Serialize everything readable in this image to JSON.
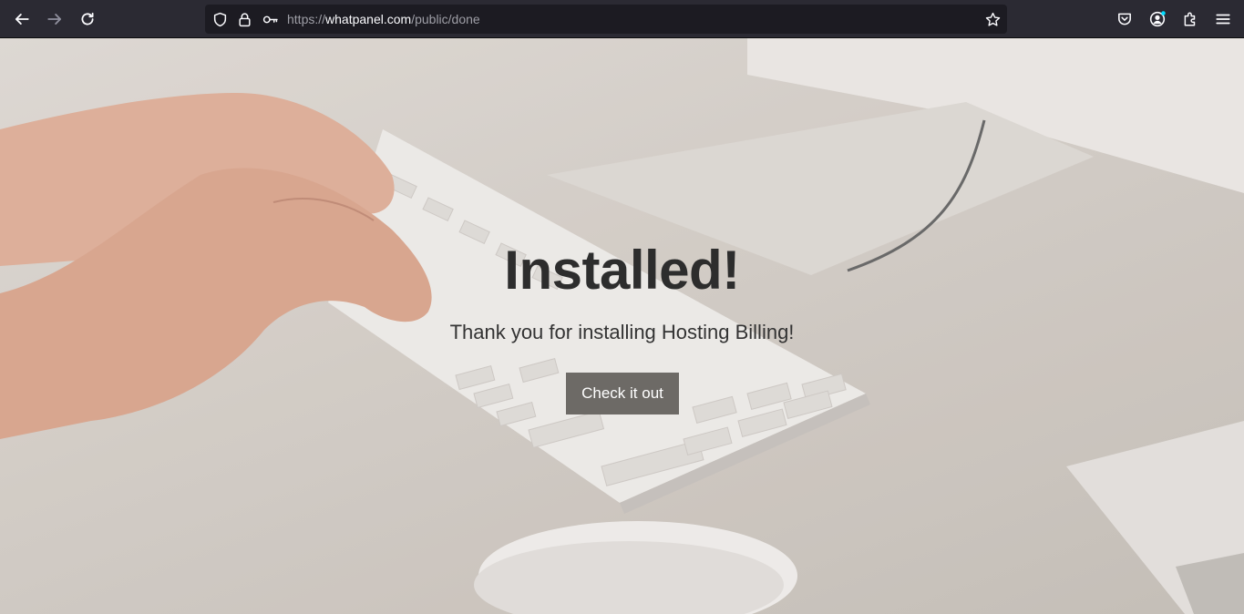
{
  "browser": {
    "url_prefix": "https://",
    "url_host": "whatpanel.com",
    "url_path": "/public/done",
    "icons": {
      "back": "arrow-left-icon",
      "forward": "arrow-right-icon",
      "reload": "reload-icon",
      "shield": "shield-icon",
      "lock": "lock-icon",
      "key": "key-icon",
      "bookmark": "star-icon",
      "pocket": "pocket-icon",
      "account": "account-icon",
      "extensions": "puzzle-icon",
      "menu": "hamburger-menu-icon"
    },
    "colors": {
      "chrome": "#2b2a33",
      "urlbar": "#1c1b22",
      "badge": "#00ddff"
    }
  },
  "page": {
    "title": "Installed!",
    "subtitle": "Thank you for installing Hosting Billing!",
    "cta_label": "Check it out",
    "colors": {
      "cta_bg": "#6d6a66",
      "text": "#2d2d2d"
    }
  }
}
